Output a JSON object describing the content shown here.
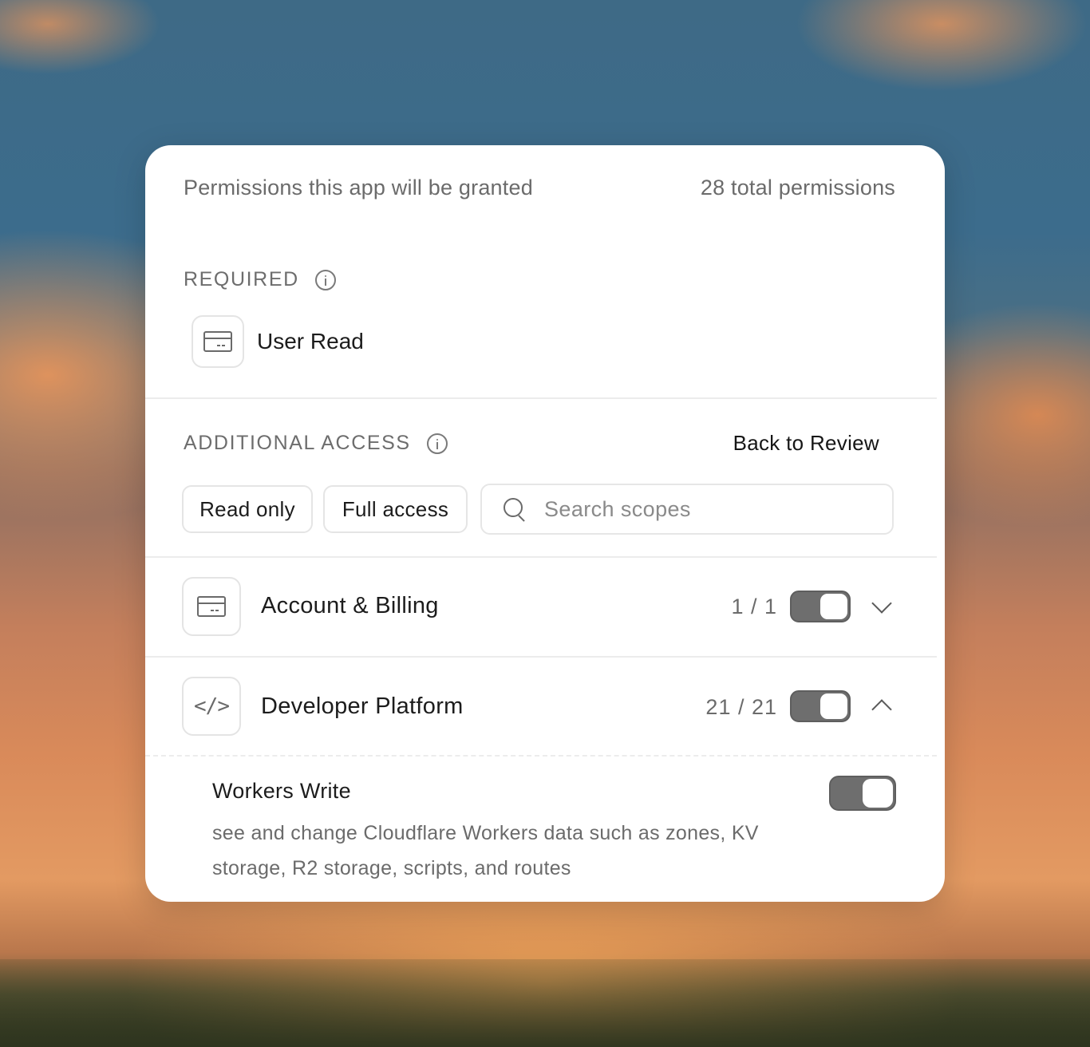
{
  "header": {
    "title": "Permissions this app will be granted",
    "total": "28 total permissions"
  },
  "required": {
    "label": "REQUIRED",
    "item": {
      "label": "User Read",
      "icon": "credit-card-icon"
    }
  },
  "additional": {
    "label": "ADDITIONAL ACCESS",
    "back_link": "Back to Review",
    "filters": {
      "read_only": "Read only",
      "full_access": "Full access"
    },
    "search": {
      "placeholder": "Search scopes",
      "value": ""
    }
  },
  "groups": [
    {
      "label": "Account & Billing",
      "count": "1 / 1",
      "icon": "credit-card-icon",
      "enabled": true,
      "expanded": false
    },
    {
      "label": "Developer Platform",
      "count": "21 / 21",
      "icon": "code-icon",
      "enabled": true,
      "expanded": true
    }
  ],
  "scope": {
    "title": "Workers Write",
    "description": "see and change Cloudflare Workers data such as zones, KV storage, R2 storage, scripts, and routes",
    "enabled": true
  }
}
